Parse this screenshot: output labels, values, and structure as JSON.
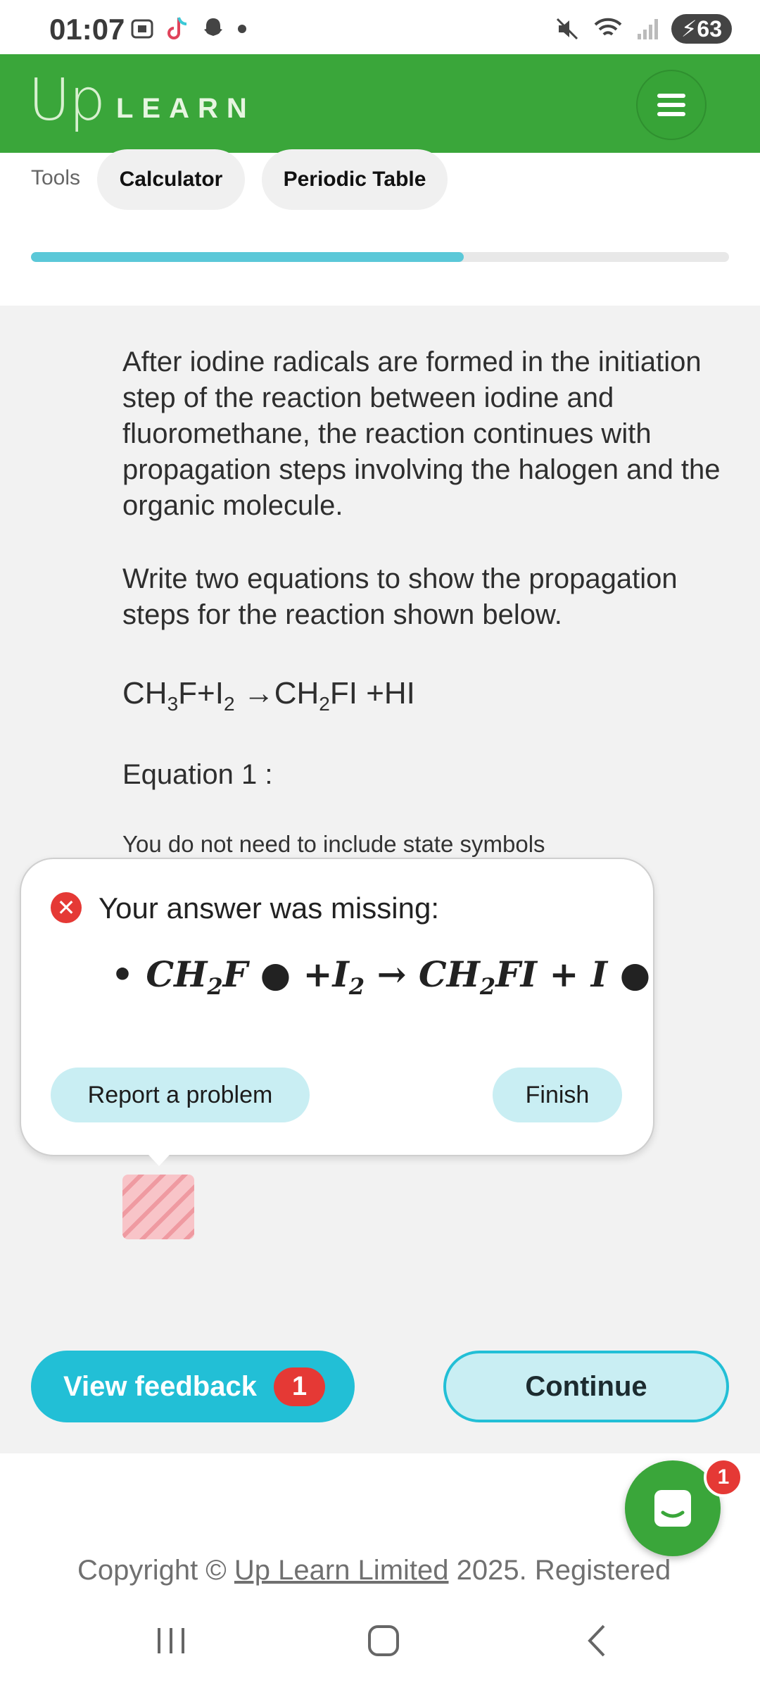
{
  "status_bar": {
    "time": "01:07",
    "battery": "63"
  },
  "header": {
    "logo_up": "Up",
    "logo_learn": "LEARN"
  },
  "tools": {
    "label": "Tools",
    "calculator": "Calculator",
    "periodic_table": "Periodic Table"
  },
  "progress": {
    "fraction": 0.62
  },
  "question": {
    "para1": "After iodine radicals are formed in the initiation step of the reaction between iodine and fluoromethane, the reaction continues with propagation steps involving the halogen and the organic molecule.",
    "para2": "Write two equations to show the propagation steps for the reaction shown below.",
    "equation_label": "Equation 1 :",
    "note": "You do not need to include state symbols"
  },
  "feedback_popup": {
    "title": "Your answer was missing:",
    "report_button": "Report a problem",
    "finish_button": "Finish"
  },
  "footer_buttons": {
    "view_feedback": "View feedback",
    "feedback_count": "1",
    "continue": "Continue"
  },
  "chat": {
    "badge": "1"
  },
  "copyright": {
    "prefix": "Copyright © ",
    "link": "Up Learn Limited",
    "suffix": " 2025. Registered"
  },
  "colors": {
    "brand_green": "#3aa63a",
    "accent_cyan": "#22bfd6",
    "error_red": "#e53935"
  }
}
